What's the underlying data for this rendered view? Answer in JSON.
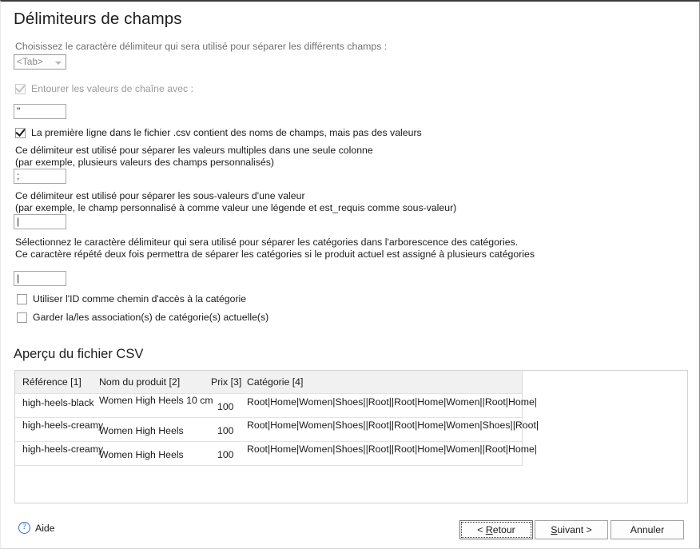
{
  "page": {
    "title": "Délimiteurs de champs"
  },
  "delimiter": {
    "instruction": "Choisissez le caractère délimiteur qui sera utilisé pour séparer les différents champs :",
    "selected": "<Tab>",
    "dropdown_icon": "chevron-down-icon"
  },
  "quote": {
    "checkbox_label": "Entourer les valeurs de chaîne avec :",
    "checked": true,
    "enabled": false,
    "value": "\""
  },
  "first_line": {
    "label": "La première ligne dans le fichier .csv contient des noms de champs, mais pas des valeurs",
    "checked": true
  },
  "multivalue": {
    "line1": "Ce délimiteur est utilisé pour séparer les valeurs multiples dans une seule colonne",
    "line2": " (par exemple, plusieurs valeurs des champs personnalisés)",
    "value": ";"
  },
  "subvalue": {
    "line1": "Ce délimiteur est utilisé pour séparer les sous-valeurs d'une valeur",
    "line2": "(par exemple, le champ personnalisé à comme valeur une légende et est_requis comme sous-valeur)",
    "value": "|"
  },
  "category": {
    "line1": "Sélectionnez le caractère délimiteur qui sera utilisé pour séparer les catégories dans l'arborescence des catégories.",
    "line2": "Ce caractère répété deux fois permettra de séparer les catégories si le produit actuel est assigné à plusieurs catégories",
    "value": "|",
    "use_id_label": "Utiliser l'ID comme chemin d'accès à la catégorie",
    "use_id_checked": false,
    "keep_assoc_label": "Garder la/les association(s) de catégorie(s) actuelle(s)",
    "keep_assoc_checked": false
  },
  "preview": {
    "title": "Aperçu du fichier CSV",
    "columns": [
      "Référence [1]",
      "Nom du produit [2]",
      "Prix [3]",
      "Catégorie [4]"
    ],
    "rows": [
      {
        "reference": "high-heels-black",
        "name": "Women High Heels 10 cm",
        "price": "100",
        "category": "Root|Home|Women|Shoes||Root||Root|Home|Women||Root|Home|"
      },
      {
        "reference": "high-heels-creamy",
        "name": "Women High Heels",
        "price": "100",
        "category": "Root|Home|Women|Shoes||Root||Root|Home|Women|Shoes||Root|"
      },
      {
        "reference": "high-heels-creamy",
        "name": "Women High Heels",
        "price": "100",
        "category": "Root|Home|Women|Shoes||Root||Root|Home|Women||Root|Home|"
      }
    ]
  },
  "footer": {
    "help_label": "Aide",
    "help_icon": "question-mark-circle-icon",
    "back_label": "< Retour",
    "back_mnemonic": "R",
    "next_label": "Suivant >",
    "next_mnemonic": "S",
    "cancel_label": "Annuler",
    "focused_button": "back"
  },
  "colors": {
    "accent": "#2b6cc4",
    "header_bg": "#f1f1f1",
    "border": "#d3d3d3"
  }
}
